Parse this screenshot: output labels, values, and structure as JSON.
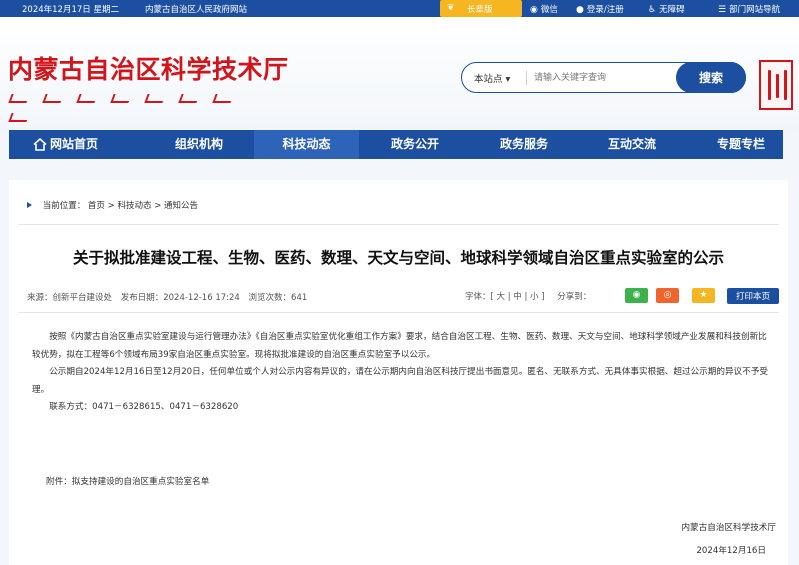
{
  "topbar": {
    "date": "2024年12月17日 星期二",
    "gov_link": "内蒙古自治区人民政府网站",
    "elder_mode": "长辈版",
    "wechat": "微信",
    "login": "登录/注册",
    "accessibility": "无障碍",
    "sitemap": "部门网站导航"
  },
  "header": {
    "logo_cn": "内蒙古自治区科学技术厅",
    "search_scope": "本站点",
    "search_placeholder": "请输入关键字查询",
    "search_button": "搜索"
  },
  "nav": {
    "items": [
      {
        "label": "网站首页"
      },
      {
        "label": "组织机构"
      },
      {
        "label": "科技动态"
      },
      {
        "label": "政务公开"
      },
      {
        "label": "政务服务"
      },
      {
        "label": "互动交流"
      },
      {
        "label": "专题专栏"
      }
    ],
    "active_index": 2
  },
  "breadcrumb": {
    "prefix": "当前位置：",
    "home": "首页",
    "sep": ">",
    "level1": "科技动态",
    "level2": "通知公告"
  },
  "article": {
    "title": "关于拟批准建设工程、生物、医药、数理、天文与空间、地球科学领域自治区重点实验室的公示",
    "source": "来源：创新平台建设处",
    "publish": "发布日期：2024-12-16 17:24",
    "views": "浏览次数：641",
    "font_size_label": "字体：[  大  |  中  |  小  ]",
    "share_label": "分享到：",
    "print_button": "打印本页",
    "paragraphs": [
      "按照《内蒙古自治区重点实验室建设与运行管理办法》《自治区重点实验室优化重组工作方案》要求，结合自治区工程、生物、医药、数理、天文与空间、地球科学领域产业发展和科技创新比较优势，拟在工程等6个领域布局39家自治区重点实验室。现将拟批准建设的自治区重点实验室予以公示。",
      "公示期自2024年12月16日至12月20日，任何单位或个人对公示内容有异议的，请在公示期内向自治区科技厅提出书面意见。匿名、无联系方式、无具体事实根据、超过公示期的异议不予受理。",
      "联系方式：0471－6328615、0471－6328620"
    ],
    "attachment": "附件：拟支持建设的自治区重点实验室名单",
    "signature": "内蒙古自治区科学技术厅",
    "sign_date": "2024年12月16日"
  },
  "colors": {
    "primary": "#1c4fa0",
    "logo_red": "#d2151b",
    "elder_yellow": "#f5b622",
    "wechat_green": "#3bb34a",
    "weibo_orange": "#f0642d",
    "star_yellow": "#f5b622"
  },
  "icons": [
    "leaf-icon",
    "wechat-icon",
    "user-icon",
    "accessibility-icon",
    "sitemap-icon",
    "home-icon",
    "share-wechat-icon",
    "share-weibo-icon",
    "share-star-icon"
  ]
}
